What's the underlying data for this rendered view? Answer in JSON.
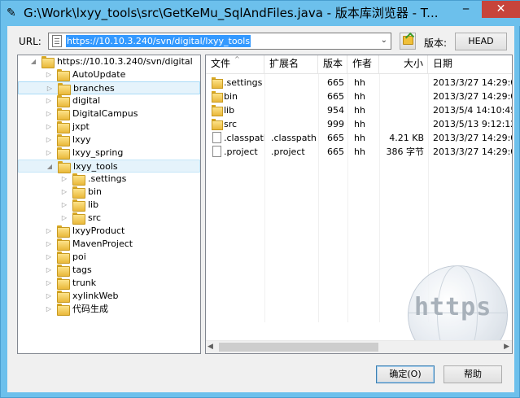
{
  "window": {
    "title": "G:\\Work\\lxyy_tools\\src\\GetKeMu_SqlAndFiles.java - 版本库浏览器 - T...",
    "app_icon": "tortoise-icon",
    "minimize_glyph": "─",
    "close_glyph": "✕"
  },
  "toolbar": {
    "url_label": "URL:",
    "url_value": "https://10.10.3.240/svn/digital/lxyy_tools",
    "dropdown_glyph": "⌄",
    "version_label": "版本:",
    "version_button": "HEAD"
  },
  "tree": {
    "expand_glyph": "◢",
    "collapse_glyph": "▷",
    "root": "https://10.10.3.240/svn/digital",
    "items": [
      {
        "label": "AutoUpdate",
        "level": 1
      },
      {
        "label": "branches",
        "level": 1,
        "state": "selected"
      },
      {
        "label": "digital",
        "level": 1
      },
      {
        "label": "DigitalCampus",
        "level": 1
      },
      {
        "label": "jxpt",
        "level": 1
      },
      {
        "label": "lxyy",
        "level": 1
      },
      {
        "label": "lxyy_spring",
        "level": 1
      },
      {
        "label": "lxyy_tools",
        "level": 1,
        "state": "expanded"
      },
      {
        "label": ".settings",
        "level": 2
      },
      {
        "label": "bin",
        "level": 2
      },
      {
        "label": "lib",
        "level": 2
      },
      {
        "label": "src",
        "level": 2
      },
      {
        "label": "lxyyProduct",
        "level": 1
      },
      {
        "label": "MavenProject",
        "level": 1
      },
      {
        "label": "poi",
        "level": 1
      },
      {
        "label": "tags",
        "level": 1
      },
      {
        "label": "trunk",
        "level": 1
      },
      {
        "label": "xylinkWeb",
        "level": 1
      },
      {
        "label": "代码生成",
        "level": 1
      }
    ]
  },
  "list": {
    "sort_glyph": "^",
    "columns": [
      "文件",
      "扩展名",
      "版本",
      "作者",
      "大小",
      "日期"
    ],
    "rows": [
      {
        "type": "folder",
        "name": ".settings",
        "ext": "",
        "rev": "665",
        "author": "hh",
        "size": "",
        "date": "2013/3/27 14:29:0..."
      },
      {
        "type": "folder",
        "name": "bin",
        "ext": "",
        "rev": "665",
        "author": "hh",
        "size": "",
        "date": "2013/3/27 14:29:0..."
      },
      {
        "type": "folder",
        "name": "lib",
        "ext": "",
        "rev": "954",
        "author": "hh",
        "size": "",
        "date": "2013/5/4 14:10:45"
      },
      {
        "type": "folder",
        "name": "src",
        "ext": "",
        "rev": "999",
        "author": "hh",
        "size": "",
        "date": "2013/5/13 9:12:12"
      },
      {
        "type": "file",
        "name": ".classpath",
        "ext": ".classpath",
        "rev": "665",
        "author": "hh",
        "size": "4.21 KB",
        "date": "2013/3/27 14:29:0..."
      },
      {
        "type": "file",
        "name": ".project",
        "ext": ".project",
        "rev": "665",
        "author": "hh",
        "size": "386 字节",
        "date": "2013/3/27 14:29:0..."
      }
    ],
    "scroll_left_glyph": "◀",
    "scroll_right_glyph": "▶"
  },
  "watermark": {
    "text": "https"
  },
  "buttons": {
    "ok": "确定(O)",
    "help": "帮助"
  }
}
